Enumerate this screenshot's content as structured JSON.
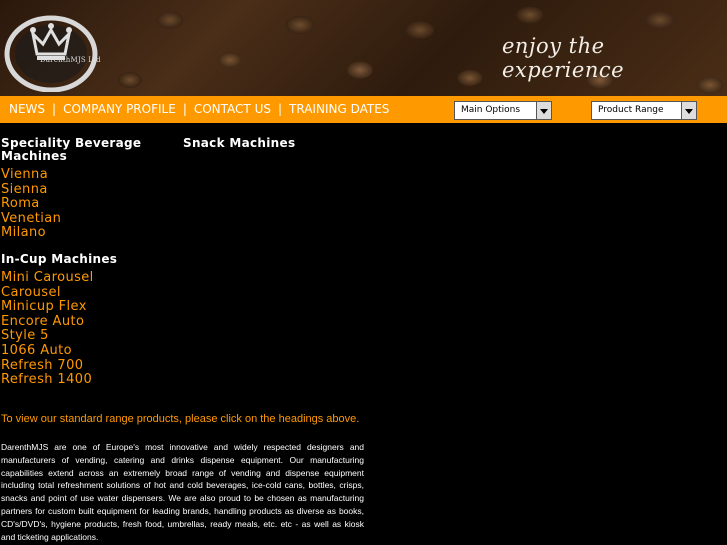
{
  "header": {
    "logo_text": "DarenthMJS Ltd",
    "tagline": "enjoy the experience"
  },
  "nav": {
    "items": [
      "NEWS",
      "COMPANY PROFILE",
      "CONTACT US",
      "TRAINING DATES"
    ],
    "separator": "|"
  },
  "selects": {
    "main_options": "Main Options",
    "product_range": "Product Range"
  },
  "sections": {
    "speciality": {
      "heading": "Speciality Beverage Machines",
      "items": [
        "Vienna",
        "Sienna",
        "Roma",
        "Venetian",
        "Milano"
      ]
    },
    "snack": {
      "heading": "Snack Machines"
    },
    "incup": {
      "heading": "In-Cup Machines",
      "items": [
        "Mini Carousel",
        "Carousel",
        "Minicup Flex",
        "Encore Auto",
        "Style 5",
        "1066 Auto",
        "Refresh 700",
        "Refresh 1400"
      ]
    }
  },
  "hint": "To view our standard range products, please click on the headings above.",
  "description": "DarenthMJS are one of Europe's most innovative and widely respected designers and manufacturers of vending, catering and drinks dispense equipment. Our manufacturing capabilities extend across an extremely broad range of vending and dispense equipment including total refreshment solutions of hot and cold beverages, ice-cold cans, bottles, crisps, snacks and point of use water dispensers. We are also proud to be chosen as manufacturing partners for custom built equipment for leading brands, handling products as diverse as books, CD's/DVD's, hygiene products, fresh food, umbrellas, ready meals, etc. etc - as well as kiosk and ticketing applications."
}
